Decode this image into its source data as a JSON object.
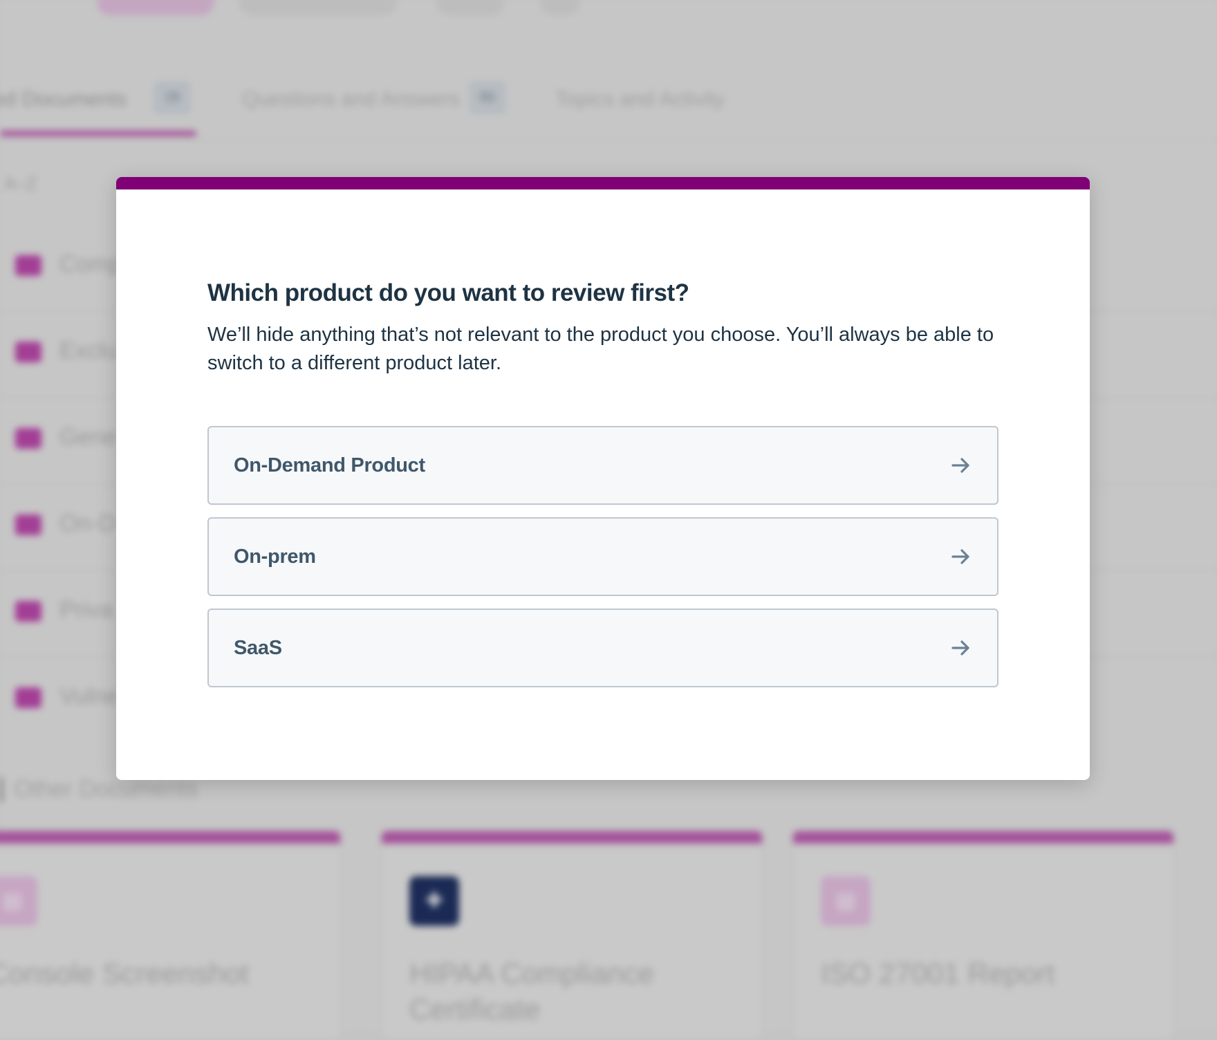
{
  "modal": {
    "title": "Which product do you want to review first?",
    "description": "We’ll hide anything that’s not relevant to the product you choose. You’ll always be able to switch to a different product later.",
    "options": [
      {
        "label": "On-Demand Product",
        "icon": "arrow-right-icon"
      },
      {
        "label": "On-prem",
        "icon": "arrow-right-icon"
      },
      {
        "label": "SaaS",
        "icon": "arrow-right-icon"
      }
    ],
    "accent_color": "#800075"
  },
  "background": {
    "tabs": [
      {
        "label": "ed Documents",
        "count": "28"
      },
      {
        "label": "Questions and Answers",
        "count": "80"
      },
      {
        "label": "Topics and Activity"
      }
    ],
    "sort_label": "A–Z",
    "folders": [
      "Comp",
      "Exclu",
      "Gene",
      "On-D",
      "Priva",
      "Vulne"
    ],
    "section_title": "Other Documents",
    "cards": [
      {
        "title": "Console Screenshot",
        "icon": "document-icon"
      },
      {
        "title": "HIPAA Compliance Certificate",
        "icon": "certificate-icon"
      },
      {
        "title": "ISO 27001 Report",
        "icon": "document-icon"
      }
    ],
    "brand_color": "#a33e95"
  }
}
